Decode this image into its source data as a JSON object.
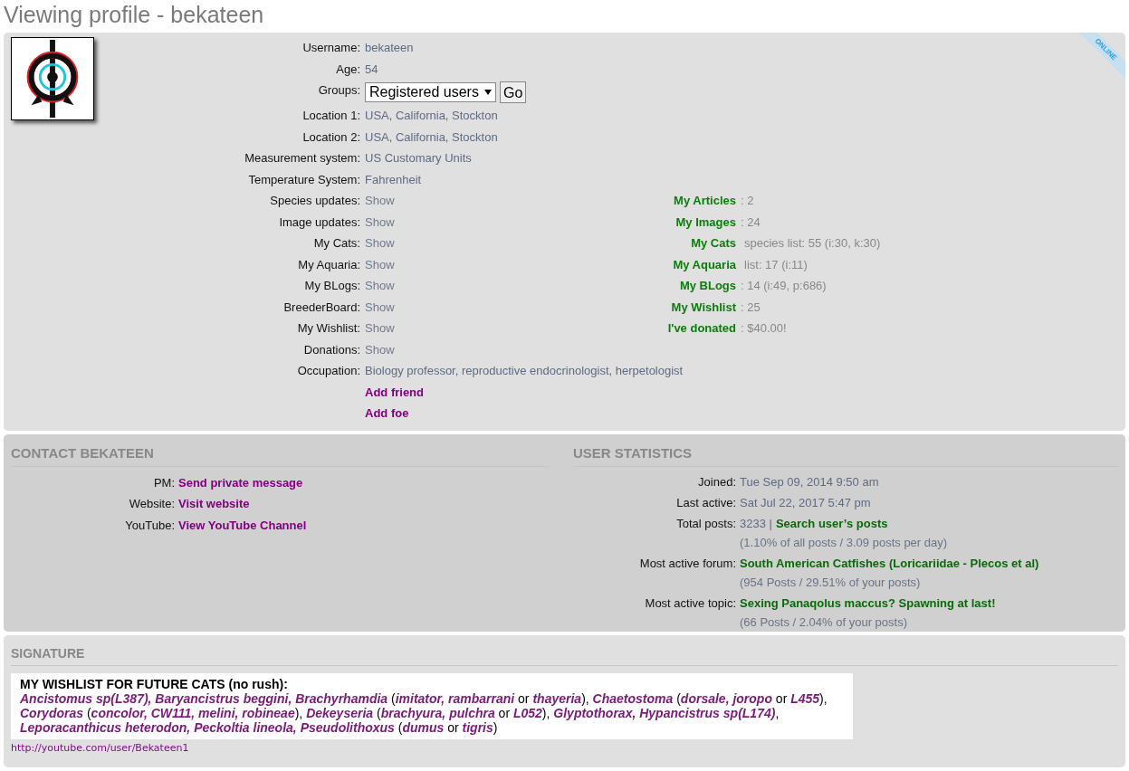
{
  "page_title": "Viewing profile - bekateen",
  "profile": {
    "online_badge": "ONLINE",
    "fields": [
      {
        "kind": "text",
        "label": "Username:",
        "value": "bekateen"
      },
      {
        "kind": "text",
        "label": "Age:",
        "value": "54"
      },
      {
        "kind": "select",
        "label": "Groups:",
        "value": "Registered users",
        "button": "Go"
      },
      {
        "kind": "text",
        "label": "Location 1:",
        "value": "USA, California, Stockton"
      },
      {
        "kind": "text",
        "label": "Location 2:",
        "value": "USA, California, Stockton"
      },
      {
        "kind": "text",
        "label": "Measurement system:",
        "value": "US Customary Units"
      },
      {
        "kind": "text",
        "label": "Temperature System:",
        "value": "Fahrenheit"
      },
      {
        "kind": "link",
        "label": "Species updates:",
        "value": "Show"
      },
      {
        "kind": "link",
        "label": "Image updates:",
        "value": "Show"
      },
      {
        "kind": "link",
        "label": "My Cats:",
        "value": "Show"
      },
      {
        "kind": "link",
        "label": "My Aquaria:",
        "value": "Show"
      },
      {
        "kind": "link",
        "label": "My BLogs:",
        "value": "Show"
      },
      {
        "kind": "link",
        "label": "BreederBoard:",
        "value": "Show"
      },
      {
        "kind": "link",
        "label": "My Wishlist:",
        "value": "Show"
      },
      {
        "kind": "link",
        "label": "Donations:",
        "value": "Show"
      },
      {
        "kind": "wide",
        "label": "Occupation:",
        "value": "Biology professor, reproductive endocrinologist, herpetologist"
      }
    ],
    "actions": [
      "Add friend",
      "Add foe"
    ],
    "stats": [
      {
        "kind": "count",
        "link": "My Articles",
        "rest": ": 2"
      },
      {
        "kind": "count",
        "link": "My Images",
        "rest": ": 24"
      },
      {
        "kind": "list",
        "link": "My Cats",
        "rest": "species list: 55 (i:30, k:30)"
      },
      {
        "kind": "list",
        "link": "My Aquaria",
        "rest": "list: 17 (i:11)"
      },
      {
        "kind": "count",
        "link": "My BLogs",
        "rest": ": 14 (i:49, p:686)"
      },
      {
        "kind": "count",
        "link": "My Wishlist",
        "rest": ": 25"
      },
      {
        "kind": "count",
        "link": "I've donated",
        "rest": ": $40.00!"
      }
    ]
  },
  "contact": {
    "heading": "CONTACT BEKATEEN",
    "rows": [
      {
        "label": "PM:",
        "link": "Send private message"
      },
      {
        "label": "Website:",
        "link": "Visit website"
      },
      {
        "label": "YouTube:",
        "link": "View YouTube Channel"
      }
    ]
  },
  "user_statistics": {
    "heading": "USER STATISTICS",
    "rows": [
      {
        "label": "Joined:",
        "value": "Tue Sep 09, 2014 9:50 am"
      },
      {
        "label": "Last active:",
        "value": "Sat Jul 22, 2017 5:47 pm"
      },
      {
        "label": "Total posts:",
        "value": "3233 |",
        "link": "Search user’s posts",
        "note": "(1.10% of all posts / 3.09 posts per day)"
      },
      {
        "label": "Most active forum:",
        "link": "South American Catfishes (Loricariidae - Plecos et al)",
        "note": "(954 Posts / 29.51% of your posts)"
      },
      {
        "label": "Most active topic:",
        "link": "Sexing Panaqolus maccus? Spawning at last!",
        "note": "(66 Posts / 2.04% of your posts)"
      }
    ]
  },
  "signature": {
    "heading": "SIGNATURE",
    "title": "MY WISHLIST FOR FUTURE CATS (no rush):",
    "lines": [
      "*Ancistomus sp(L387), Baryancistrus beggini, Brachyrhamdia* (*imitator, rambarrani* or *thayeria*), *Chaetostoma* (*dorsale, joropo* or *L455*),",
      "*Corydoras* (*concolor, CW111, melini, robineae*), *Dekeyseria* (*brachyura, pulchra* or *L052*), *Glyptothorax, Hypancistrus sp(L174)*,",
      "*Leporacanthicus heterodon, Peckoltia lineola, Pseudolithoxus* (*dumus* or *tigris*)"
    ],
    "link": "http://youtube.com/user/Bekateen1"
  }
}
